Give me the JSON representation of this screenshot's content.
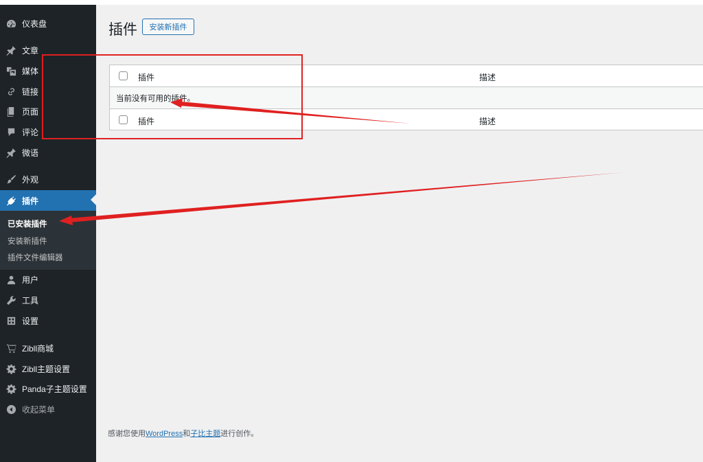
{
  "sidebar": {
    "items": [
      {
        "label": "仪表盘",
        "icon": "dashboard-icon"
      },
      {
        "label": "文章",
        "icon": "pushpin-icon"
      },
      {
        "label": "媒体",
        "icon": "media-icon"
      },
      {
        "label": "链接",
        "icon": "link-icon"
      },
      {
        "label": "页面",
        "icon": "page-icon"
      },
      {
        "label": "评论",
        "icon": "comment-icon"
      },
      {
        "label": "微语",
        "icon": "pushpin-icon"
      },
      {
        "label": "外观",
        "icon": "brush-icon"
      },
      {
        "label": "插件",
        "icon": "plugin-icon",
        "active": true
      },
      {
        "label": "用户",
        "icon": "user-icon"
      },
      {
        "label": "工具",
        "icon": "wrench-icon"
      },
      {
        "label": "设置",
        "icon": "settings-icon"
      },
      {
        "label": "Zibll商城",
        "icon": "cart-icon"
      },
      {
        "label": "Zibll主题设置",
        "icon": "gear-icon"
      },
      {
        "label": "Panda子主题设置",
        "icon": "gear-icon"
      },
      {
        "label": "收起菜单",
        "icon": "collapse-icon"
      }
    ],
    "submenu": [
      {
        "label": "已安装插件",
        "current": true
      },
      {
        "label": "安装新插件"
      },
      {
        "label": "插件文件编辑器"
      }
    ]
  },
  "main": {
    "title": "插件",
    "add_new_label": "安装新插件",
    "table": {
      "col_plugin": "插件",
      "col_description": "描述",
      "empty_message": "当前没有可用的插件。"
    }
  },
  "footer": {
    "prefix": "感谢您使用",
    "link1": "WordPress",
    "middle": "和",
    "link2": "子比主题",
    "suffix": "进行创作。"
  },
  "colors": {
    "sidebar_bg": "#1d2327",
    "active_bg": "#2271b1",
    "annotation": "#e02020"
  }
}
